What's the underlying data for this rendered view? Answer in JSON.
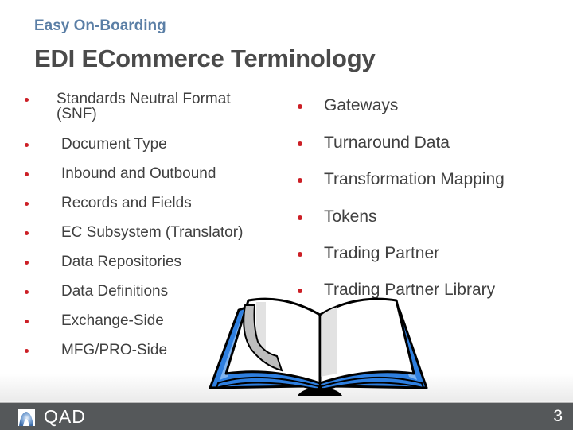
{
  "header": {
    "section_label": "Easy On-Boarding",
    "title": "EDI ECommerce Terminology"
  },
  "left_column": {
    "items": [
      {
        "label": "Standards Neutral Format",
        "label_line2": "(SNF)"
      },
      {
        "label": "Document Type"
      },
      {
        "label": "Inbound and Outbound"
      },
      {
        "label": "Records and Fields"
      },
      {
        "label": "EC Subsystem (Translator)"
      },
      {
        "label": "Data Repositories"
      },
      {
        "label": "Data Definitions"
      },
      {
        "label": "Exchange-Side"
      },
      {
        "label": "MFG/PRO-Side"
      }
    ]
  },
  "right_column": {
    "items": [
      {
        "label": "Gateways"
      },
      {
        "label": "Turnaround Data"
      },
      {
        "label": "Transformation Mapping"
      },
      {
        "label": "Tokens"
      },
      {
        "label": "Trading Partner"
      },
      {
        "label": "Trading Partner Library"
      }
    ]
  },
  "illustration": {
    "icon": "open-book-icon"
  },
  "footer": {
    "logo_text": "QAD",
    "page_number": "3"
  },
  "colors": {
    "section_label": "#5b7fa6",
    "title": "#4a4a4a",
    "bullet": "#cc1f26",
    "footer_bg": "#55585a",
    "book_blue": "#2e7fe0"
  }
}
